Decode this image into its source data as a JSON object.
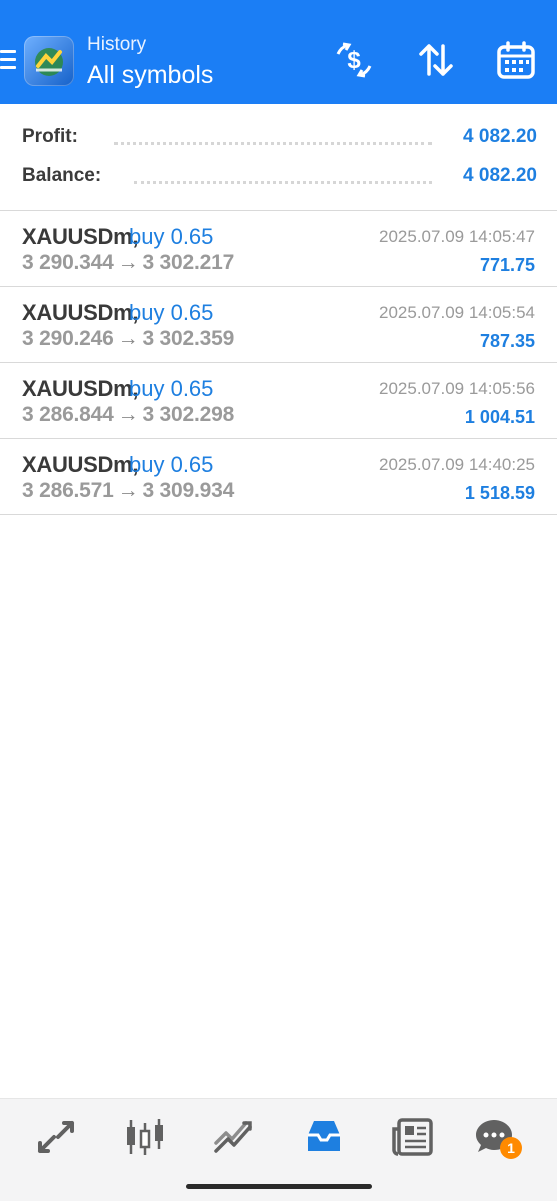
{
  "header": {
    "subtitle": "History",
    "title": "All symbols"
  },
  "summary": {
    "profit_label": "Profit:",
    "profit_value": "4 082.20",
    "balance_label": "Balance:",
    "balance_value": "4 082.20"
  },
  "deals": [
    {
      "symbol": "XAUUSDm,",
      "direction": "buy 0.65",
      "open": "3 290.344",
      "close": "3 302.217",
      "time": "2025.07.09 14:05:47",
      "profit": "771.75"
    },
    {
      "symbol": "XAUUSDm,",
      "direction": "buy 0.65",
      "open": "3 290.246",
      "close": "3 302.359",
      "time": "2025.07.09 14:05:54",
      "profit": "787.35"
    },
    {
      "symbol": "XAUUSDm,",
      "direction": "buy 0.65",
      "open": "3 286.844",
      "close": "3 302.298",
      "time": "2025.07.09 14:05:56",
      "profit": "1 004.51"
    },
    {
      "symbol": "XAUUSDm,",
      "direction": "buy 0.65",
      "open": "3 286.571",
      "close": "3 309.934",
      "time": "2025.07.09 14:40:25",
      "profit": "1 518.59"
    }
  ],
  "arrow": "→",
  "nav": {
    "chat_badge": "1",
    "items": [
      "quotes-icon",
      "chart-icon",
      "trade-icon",
      "history-icon",
      "news-icon",
      "chat-icon"
    ]
  },
  "colors": {
    "header_bg": "#1b7ef5",
    "accent": "#1e7fe0",
    "badge": "#ff8a00"
  }
}
